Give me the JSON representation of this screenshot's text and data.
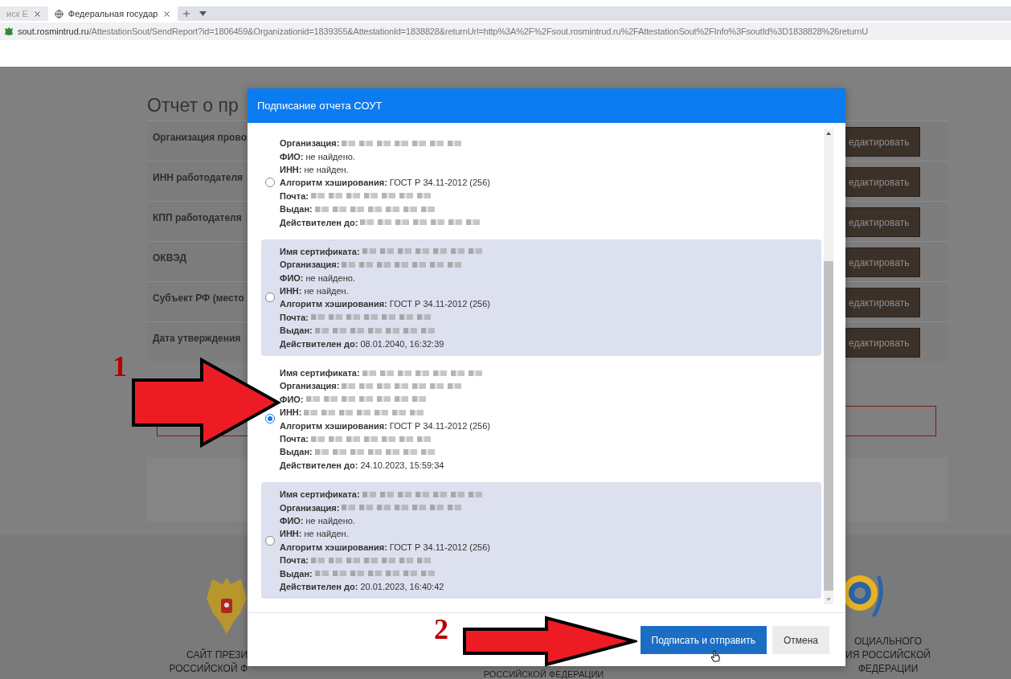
{
  "browser": {
    "tabs": [
      {
        "title": "иск Е",
        "selected": false
      },
      {
        "title": "Федеральная государ",
        "selected": true
      }
    ],
    "address": {
      "host": "sout.rosmintrud.ru",
      "path": "/AttestationSout/SendReport?id=1806459&Organizationid=1839355&AttestationId=1838828&returnUrl=http%3A%2F%2Fsout.rosmintrud.ru%2FAttestationSout%2FInfo%3FsoutId%3D1838828%26returnU"
    }
  },
  "page": {
    "title": "Отчет о пр",
    "rows": [
      {
        "label": "Организация прово",
        "button": "едактировать"
      },
      {
        "label": "ИНН работодателя",
        "button": "едактировать"
      },
      {
        "label": "КПП работодателя",
        "button": "едактировать"
      },
      {
        "label": "ОКВЭД",
        "button": "едактировать"
      },
      {
        "label": "Субъект РФ (место",
        "button": "едактировать"
      },
      {
        "label": "Дата утверждения",
        "button": "едактировать"
      }
    ],
    "footer": {
      "left": [
        "САЙТ ПРЕЗИ",
        "РОССИЙСКОЙ Ф"
      ],
      "center": [
        "РОССИЙСКОЙ ФЕДЕРАЦИИ"
      ],
      "right": [
        "ОЦИАЛЬНОГО",
        "ИЯ РОССИЙСКОЙ",
        "ФЕДЕРАЦИИ"
      ]
    }
  },
  "dialog": {
    "title": "Подписание отчета СОУТ",
    "certificates": [
      {
        "selected": false,
        "fields": [
          {
            "label": "Организация:",
            "kind": "blurred"
          },
          {
            "label": "ФИО:",
            "kind": "text",
            "value": "не найдено."
          },
          {
            "label": "ИНН:",
            "kind": "text",
            "value": "не найден."
          },
          {
            "label": "Алгоритм хэширования:",
            "kind": "text",
            "value": "ГОСТ Р 34.11-2012 (256)"
          },
          {
            "label": "Почта:",
            "kind": "blurred"
          },
          {
            "label": "Выдан:",
            "kind": "blurred"
          },
          {
            "label": "Действителен до:",
            "kind": "blurred"
          }
        ]
      },
      {
        "selected": false,
        "fields": [
          {
            "label": "Имя сертификата:",
            "kind": "blurred"
          },
          {
            "label": "Организация:",
            "kind": "blurred"
          },
          {
            "label": "ФИО:",
            "kind": "text",
            "value": "не найдено."
          },
          {
            "label": "ИНН:",
            "kind": "text",
            "value": "не найден."
          },
          {
            "label": "Алгоритм хэширования:",
            "kind": "text",
            "value": "ГОСТ Р 34.11-2012 (256)"
          },
          {
            "label": "Почта:",
            "kind": "blurred"
          },
          {
            "label": "Выдан:",
            "kind": "blurred"
          },
          {
            "label": "Действителен до:",
            "kind": "text",
            "value": "08.01.2040, 16:32:39"
          }
        ]
      },
      {
        "selected": true,
        "fields": [
          {
            "label": "Имя сертификата:",
            "kind": "blurred"
          },
          {
            "label": "Организация:",
            "kind": "blurred"
          },
          {
            "label": "ФИО:",
            "kind": "blurred"
          },
          {
            "label": "ИНН:",
            "kind": "blurred"
          },
          {
            "label": "Алгоритм хэширования:",
            "kind": "text",
            "value": "ГОСТ Р 34.11-2012 (256)"
          },
          {
            "label": "Почта:",
            "kind": "blurred"
          },
          {
            "label": "Выдан:",
            "kind": "blurred"
          },
          {
            "label": "Действителен до:",
            "kind": "text",
            "value": "24.10.2023, 15:59:34"
          }
        ]
      },
      {
        "selected": false,
        "fields": [
          {
            "label": "Имя сертификата:",
            "kind": "blurred"
          },
          {
            "label": "Организация:",
            "kind": "blurred"
          },
          {
            "label": "ФИО:",
            "kind": "text",
            "value": "не найдено."
          },
          {
            "label": "ИНН:",
            "kind": "text",
            "value": "не найден."
          },
          {
            "label": "Алгоритм хэширования:",
            "kind": "text",
            "value": "ГОСТ Р 34.11-2012 (256)"
          },
          {
            "label": "Почта:",
            "kind": "blurred"
          },
          {
            "label": "Выдан:",
            "kind": "blurred"
          },
          {
            "label": "Действителен до:",
            "kind": "text",
            "value": "20.01.2023, 16:40:42"
          }
        ]
      }
    ],
    "buttons": [
      {
        "label": "Подписать и отправить",
        "kind": "primary"
      },
      {
        "label": "Отмена",
        "kind": "secondary"
      }
    ]
  },
  "annotations": [
    {
      "number": "1"
    },
    {
      "number": "2"
    }
  ]
}
